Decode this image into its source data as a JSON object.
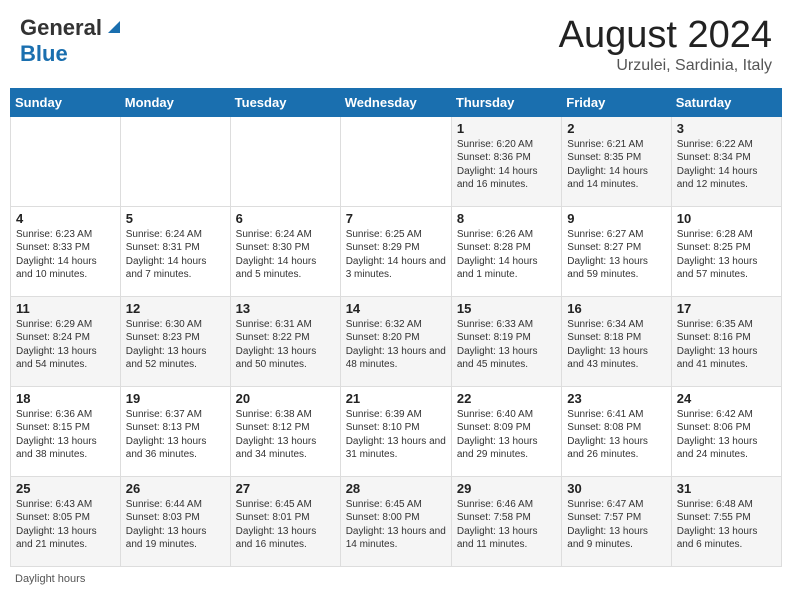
{
  "header": {
    "logo_general": "General",
    "logo_blue": "Blue",
    "month": "August 2024",
    "location": "Urzulei, Sardinia, Italy"
  },
  "days_of_week": [
    "Sunday",
    "Monday",
    "Tuesday",
    "Wednesday",
    "Thursday",
    "Friday",
    "Saturday"
  ],
  "weeks": [
    [
      {
        "day": "",
        "info": ""
      },
      {
        "day": "",
        "info": ""
      },
      {
        "day": "",
        "info": ""
      },
      {
        "day": "",
        "info": ""
      },
      {
        "day": "1",
        "info": "Sunrise: 6:20 AM\nSunset: 8:36 PM\nDaylight: 14 hours and 16 minutes."
      },
      {
        "day": "2",
        "info": "Sunrise: 6:21 AM\nSunset: 8:35 PM\nDaylight: 14 hours and 14 minutes."
      },
      {
        "day": "3",
        "info": "Sunrise: 6:22 AM\nSunset: 8:34 PM\nDaylight: 14 hours and 12 minutes."
      }
    ],
    [
      {
        "day": "4",
        "info": "Sunrise: 6:23 AM\nSunset: 8:33 PM\nDaylight: 14 hours and 10 minutes."
      },
      {
        "day": "5",
        "info": "Sunrise: 6:24 AM\nSunset: 8:31 PM\nDaylight: 14 hours and 7 minutes."
      },
      {
        "day": "6",
        "info": "Sunrise: 6:24 AM\nSunset: 8:30 PM\nDaylight: 14 hours and 5 minutes."
      },
      {
        "day": "7",
        "info": "Sunrise: 6:25 AM\nSunset: 8:29 PM\nDaylight: 14 hours and 3 minutes."
      },
      {
        "day": "8",
        "info": "Sunrise: 6:26 AM\nSunset: 8:28 PM\nDaylight: 14 hours and 1 minute."
      },
      {
        "day": "9",
        "info": "Sunrise: 6:27 AM\nSunset: 8:27 PM\nDaylight: 13 hours and 59 minutes."
      },
      {
        "day": "10",
        "info": "Sunrise: 6:28 AM\nSunset: 8:25 PM\nDaylight: 13 hours and 57 minutes."
      }
    ],
    [
      {
        "day": "11",
        "info": "Sunrise: 6:29 AM\nSunset: 8:24 PM\nDaylight: 13 hours and 54 minutes."
      },
      {
        "day": "12",
        "info": "Sunrise: 6:30 AM\nSunset: 8:23 PM\nDaylight: 13 hours and 52 minutes."
      },
      {
        "day": "13",
        "info": "Sunrise: 6:31 AM\nSunset: 8:22 PM\nDaylight: 13 hours and 50 minutes."
      },
      {
        "day": "14",
        "info": "Sunrise: 6:32 AM\nSunset: 8:20 PM\nDaylight: 13 hours and 48 minutes."
      },
      {
        "day": "15",
        "info": "Sunrise: 6:33 AM\nSunset: 8:19 PM\nDaylight: 13 hours and 45 minutes."
      },
      {
        "day": "16",
        "info": "Sunrise: 6:34 AM\nSunset: 8:18 PM\nDaylight: 13 hours and 43 minutes."
      },
      {
        "day": "17",
        "info": "Sunrise: 6:35 AM\nSunset: 8:16 PM\nDaylight: 13 hours and 41 minutes."
      }
    ],
    [
      {
        "day": "18",
        "info": "Sunrise: 6:36 AM\nSunset: 8:15 PM\nDaylight: 13 hours and 38 minutes."
      },
      {
        "day": "19",
        "info": "Sunrise: 6:37 AM\nSunset: 8:13 PM\nDaylight: 13 hours and 36 minutes."
      },
      {
        "day": "20",
        "info": "Sunrise: 6:38 AM\nSunset: 8:12 PM\nDaylight: 13 hours and 34 minutes."
      },
      {
        "day": "21",
        "info": "Sunrise: 6:39 AM\nSunset: 8:10 PM\nDaylight: 13 hours and 31 minutes."
      },
      {
        "day": "22",
        "info": "Sunrise: 6:40 AM\nSunset: 8:09 PM\nDaylight: 13 hours and 29 minutes."
      },
      {
        "day": "23",
        "info": "Sunrise: 6:41 AM\nSunset: 8:08 PM\nDaylight: 13 hours and 26 minutes."
      },
      {
        "day": "24",
        "info": "Sunrise: 6:42 AM\nSunset: 8:06 PM\nDaylight: 13 hours and 24 minutes."
      }
    ],
    [
      {
        "day": "25",
        "info": "Sunrise: 6:43 AM\nSunset: 8:05 PM\nDaylight: 13 hours and 21 minutes."
      },
      {
        "day": "26",
        "info": "Sunrise: 6:44 AM\nSunset: 8:03 PM\nDaylight: 13 hours and 19 minutes."
      },
      {
        "day": "27",
        "info": "Sunrise: 6:45 AM\nSunset: 8:01 PM\nDaylight: 13 hours and 16 minutes."
      },
      {
        "day": "28",
        "info": "Sunrise: 6:45 AM\nSunset: 8:00 PM\nDaylight: 13 hours and 14 minutes."
      },
      {
        "day": "29",
        "info": "Sunrise: 6:46 AM\nSunset: 7:58 PM\nDaylight: 13 hours and 11 minutes."
      },
      {
        "day": "30",
        "info": "Sunrise: 6:47 AM\nSunset: 7:57 PM\nDaylight: 13 hours and 9 minutes."
      },
      {
        "day": "31",
        "info": "Sunrise: 6:48 AM\nSunset: 7:55 PM\nDaylight: 13 hours and 6 minutes."
      }
    ]
  ],
  "footer": {
    "daylight_label": "Daylight hours"
  }
}
